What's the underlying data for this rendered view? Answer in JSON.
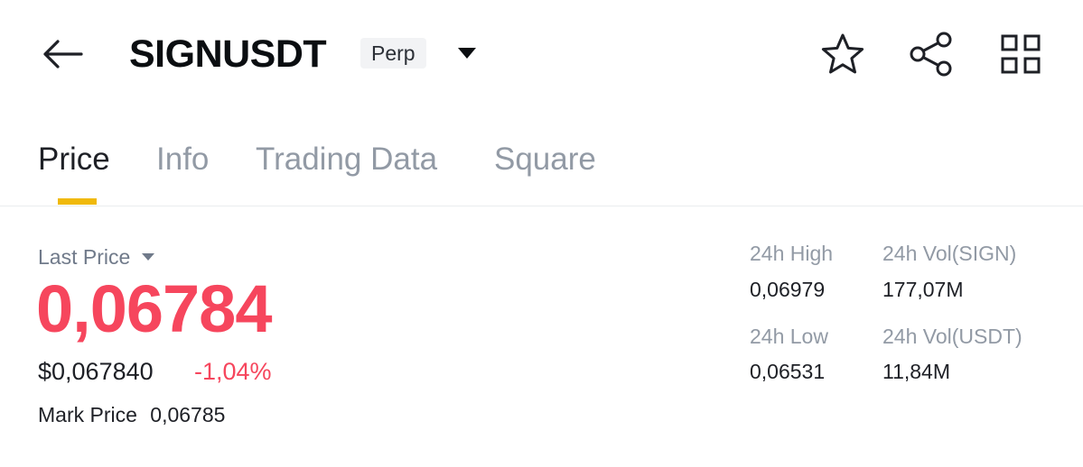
{
  "header": {
    "symbol": "SIGNUSDT",
    "badge": "Perp",
    "icons": {
      "back": "arrow-left-icon",
      "dropdown": "caret-down-icon",
      "favorite": "star-icon",
      "share": "share-icon",
      "more": "grid-icon"
    }
  },
  "tabs": [
    {
      "label": "Price",
      "active": true
    },
    {
      "label": "Info",
      "active": false
    },
    {
      "label": "Trading Data",
      "active": false
    },
    {
      "label": "Square",
      "active": false
    }
  ],
  "price": {
    "last_price_label": "Last Price",
    "last_price": "0,06784",
    "usd_price": "$0,067840",
    "change_pct": "-1,04%",
    "mark_price_label": "Mark Price",
    "mark_price": "0,06785"
  },
  "stats": {
    "high_label": "24h High",
    "high_value": "0,06979",
    "low_label": "24h Low",
    "low_value": "0,06531",
    "vol_base_label": "24h Vol(SIGN)",
    "vol_base_value": "177,07M",
    "vol_quote_label": "24h Vol(USDT)",
    "vol_quote_value": "11,84M"
  },
  "colors": {
    "down": "#f6465d",
    "accent": "#f0b90b",
    "text_primary": "#1e2026",
    "text_secondary": "#929aa5"
  }
}
